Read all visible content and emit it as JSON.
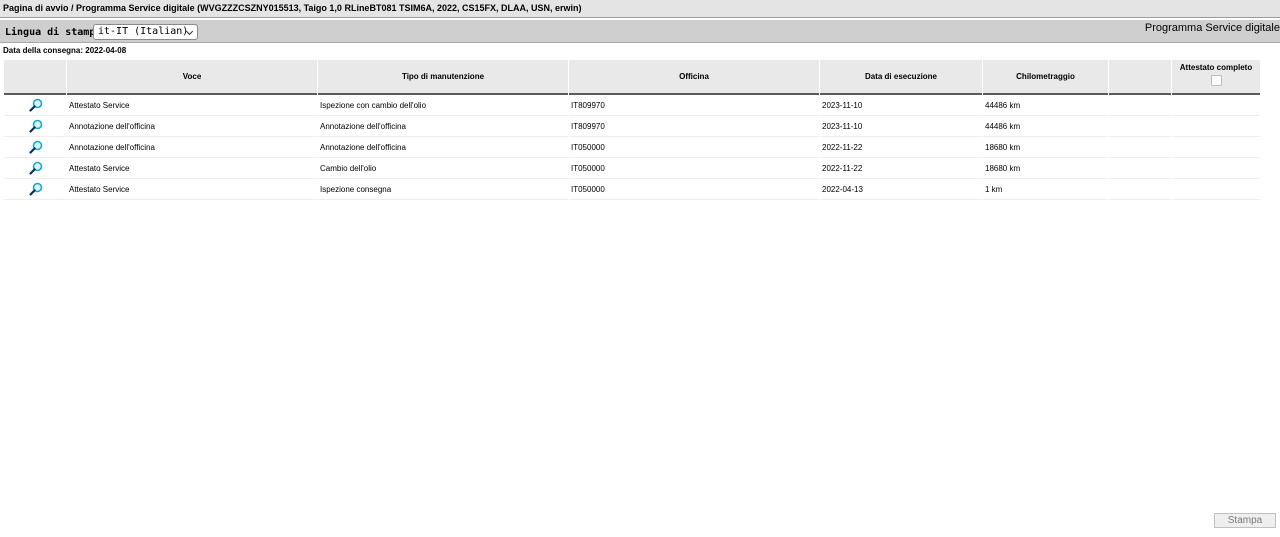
{
  "breadcrumb": "Pagina di avvio / Programma Service digitale (WVGZZZCSZNY015513, Taigo 1,0 RLineBT081 TSIM6A, 2022, CS15FX, DLAA, USN, erwin)",
  "toolbar": {
    "language_label": "Lingua di stampa:",
    "language_value": "it-IT (Italian)",
    "app_title": "Programma Service digitale"
  },
  "delivery_date": "Data della consegna: 2022-04-08",
  "table": {
    "headers": [
      "",
      "Voce",
      "Tipo di manutenzione",
      "Officina",
      "Data di esecuzione",
      "Chilometraggio",
      "",
      "Attestato completo"
    ],
    "rows": [
      {
        "voce": "Attestato Service",
        "tipo": "Ispezione con cambio dell'olio",
        "officina": "IT809970",
        "data": "2023-11-10",
        "km": "44486 km"
      },
      {
        "voce": "Annotazione dell'officina",
        "tipo": "Annotazione dell'officina",
        "officina": "IT809970",
        "data": "2023-11-10",
        "km": "44486 km"
      },
      {
        "voce": "Annotazione dell'officina",
        "tipo": "Annotazione dell'officina",
        "officina": "IT050000",
        "data": "2022-11-22",
        "km": "18680 km"
      },
      {
        "voce": "Attestato Service",
        "tipo": "Cambio dell'olio",
        "officina": "IT050000",
        "data": "2022-11-22",
        "km": "18680 km"
      },
      {
        "voce": "Attestato Service",
        "tipo": "Ispezione consegna",
        "officina": "IT050000",
        "data": "2022-04-13",
        "km": "1 km"
      }
    ]
  },
  "print_button": "Stampa",
  "icons": {
    "row_action": "magnifier-icon",
    "select": "chevron-down-icon"
  },
  "colors": {
    "breadcrumb_bg": "#e4e4e4",
    "toolbar_bg": "#cfcfcf",
    "header_bg": "#e9e9e9",
    "magnifier": "#1aa8c8"
  }
}
